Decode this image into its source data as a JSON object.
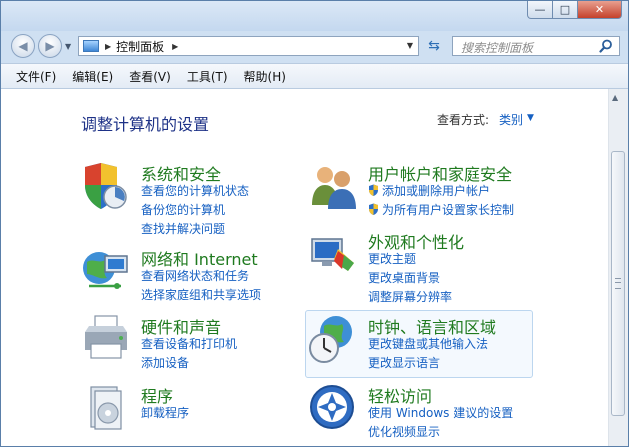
{
  "window": {
    "minimize_label": "—",
    "maximize_label": "□",
    "close_label": "✕"
  },
  "navigation": {
    "back_label": "◀",
    "forward_label": "▶",
    "dropdown_label": "▼",
    "breadcrumb_arrow": "▶",
    "address_current": "控制面板",
    "address_arrow": "▶",
    "address_dropdown": "▼",
    "refresh_label": "⇆",
    "search_placeholder": "搜索控制面板"
  },
  "menu": {
    "file": "文件(F)",
    "edit": "编辑(E)",
    "view": "查看(V)",
    "tools": "工具(T)",
    "help": "帮助(H)"
  },
  "main": {
    "heading": "调整计算机的设置",
    "view_by_label": "查看方式:",
    "view_by_value": "类别",
    "view_by_arrow": "▼"
  },
  "categories": {
    "system_security": {
      "title": "系统和安全",
      "links": [
        "查看您的计算机状态",
        "备份您的计算机",
        "查找并解决问题"
      ],
      "icon": "shield-icon"
    },
    "user_accounts": {
      "title": "用户帐户和家庭安全",
      "links": [
        "添加或删除用户帐户",
        "为所有用户设置家长控制"
      ],
      "icon": "users-icon"
    },
    "network": {
      "title": "网络和 Internet",
      "links": [
        "查看网络状态和任务",
        "选择家庭组和共享选项"
      ],
      "icon": "globe-network-icon"
    },
    "appearance": {
      "title": "外观和个性化",
      "links": [
        "更改主题",
        "更改桌面背景",
        "调整屏幕分辨率"
      ],
      "icon": "monitor-palette-icon"
    },
    "hardware": {
      "title": "硬件和声音",
      "links": [
        "查看设备和打印机",
        "添加设备"
      ],
      "icon": "printer-icon"
    },
    "clock": {
      "title": "时钟、语言和区域",
      "links": [
        "更改键盘或其他输入法",
        "更改显示语言"
      ],
      "icon": "globe-clock-icon"
    },
    "programs": {
      "title": "程序",
      "links": [
        "卸载程序"
      ],
      "icon": "programs-icon"
    },
    "ease": {
      "title": "轻松访问",
      "links": [
        "使用 Windows 建议的设置",
        "优化视频显示"
      ],
      "icon": "accessibility-icon"
    }
  },
  "scrollbar": {
    "up_label": "▲"
  }
}
